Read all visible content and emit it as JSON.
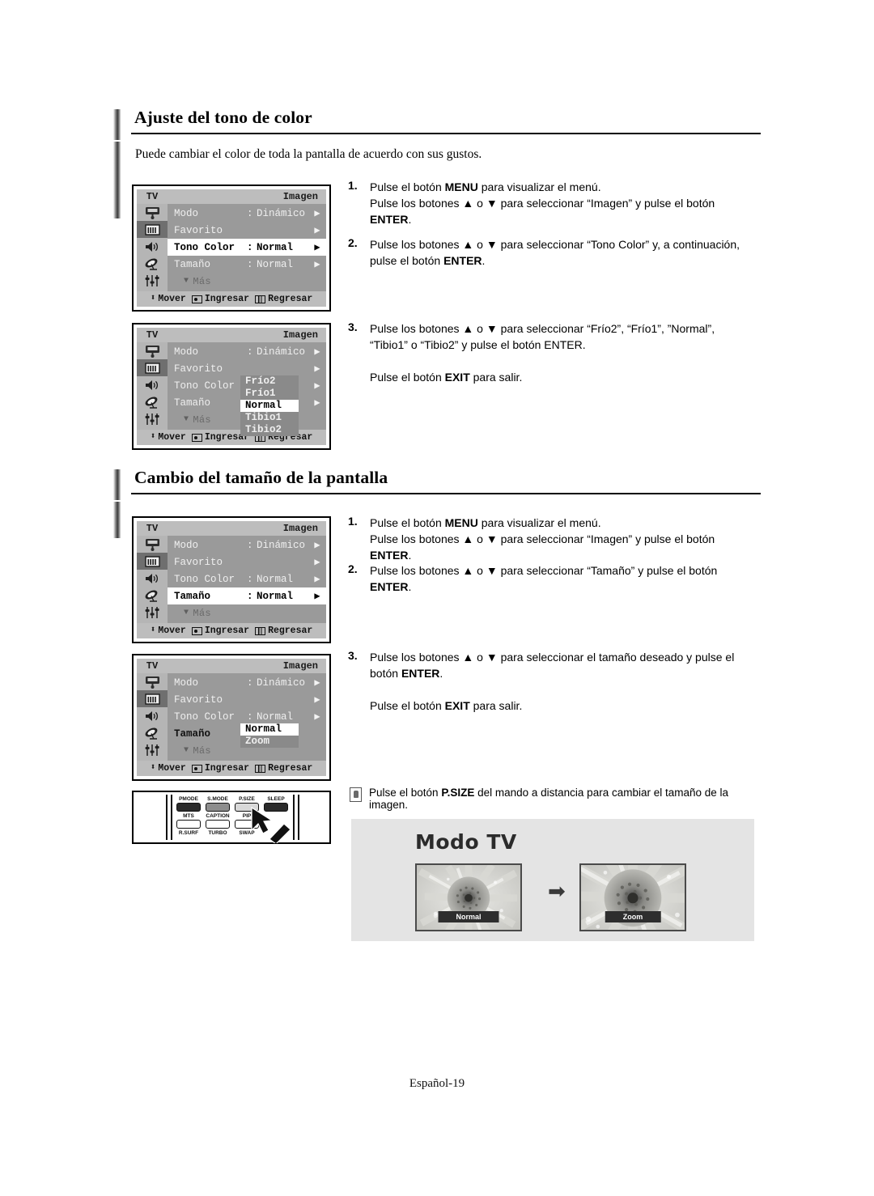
{
  "page": {
    "footer": "Español-19"
  },
  "sections": [
    {
      "heading": "Ajuste del tono de color",
      "intro": "Puede cambiar el color de toda la pantalla de acuerdo con sus gustos."
    },
    {
      "heading": "Cambio del tamaño de la pantalla",
      "intro": ""
    }
  ],
  "osd": {
    "tv_label": "TV",
    "title": "Imagen",
    "footer": {
      "move": "Mover",
      "enter": "Ingresar",
      "return": "Regresar",
      "move_icon": "up-down-arrow-icon",
      "enter_icon": "enter-button-icon",
      "return_icon": "menu-button-icon"
    },
    "more_label": "Más",
    "rail_icons": [
      "tv-input-icon",
      "picture-bars-icon",
      "speaker-icon",
      "satellite-dish-icon",
      "sliders-icon"
    ],
    "rows": {
      "modo": {
        "label": "Modo",
        "colon": ":",
        "value": "Dinámico"
      },
      "favorito": {
        "label": "Favorito",
        "colon": "",
        "value": ""
      },
      "tono_color": {
        "label": "Tono Color",
        "colon": ":",
        "value": "Normal"
      },
      "tamano": {
        "label": "Tamaño",
        "colon": ":",
        "value": "Normal"
      }
    },
    "tono_color_options": [
      "Frío2",
      "Frío1",
      "Normal",
      "Tibio1",
      "Tibio2"
    ],
    "tono_color_selected": "Normal",
    "tamano_options": [
      "Normal",
      "Zoom"
    ],
    "tamano_selected": "Normal"
  },
  "instructions_color": [
    {
      "num": "1.",
      "lines": [
        [
          {
            "t": "Pulse el botón "
          },
          {
            "t": "MENU",
            "b": true
          },
          {
            "t": " para visualizar el menú."
          }
        ],
        [
          {
            "t": "Pulse los botones ▲ o ▼ para seleccionar “Imagen” y pulse el botón"
          }
        ],
        [
          {
            "t": "ENTER",
            "b": true
          },
          {
            "t": "."
          }
        ]
      ]
    },
    {
      "num": "2.",
      "lines": [
        [
          {
            "t": "Pulse los botones ▲ o ▼ para seleccionar “Tono Color” y, a continuación,"
          }
        ],
        [
          {
            "t": "pulse el botón "
          },
          {
            "t": "ENTER",
            "b": true
          },
          {
            "t": "."
          }
        ]
      ]
    },
    {
      "num": "3.",
      "lines": [
        [
          {
            "t": "Pulse los botones ▲ o ▼ para seleccionar “Frío2”, “Frío1”, ”Normal”,"
          }
        ],
        [
          {
            "t": "“Tibio1” o “Tibio2” y pulse el botón ENTER."
          }
        ],
        [
          {
            "t": ""
          }
        ],
        [
          {
            "t": "Pulse el botón "
          },
          {
            "t": "EXIT",
            "b": true
          },
          {
            "t": " para salir."
          }
        ]
      ]
    }
  ],
  "instructions_size": [
    {
      "num": "1.",
      "lines": [
        [
          {
            "t": "Pulse el botón "
          },
          {
            "t": "MENU",
            "b": true
          },
          {
            "t": " para visualizar el menú."
          }
        ],
        [
          {
            "t": "Pulse los botones ▲ o ▼ para seleccionar “Imagen” y pulse el botón"
          }
        ],
        [
          {
            "t": "ENTER",
            "b": true
          },
          {
            "t": "."
          }
        ]
      ]
    },
    {
      "num": "2.",
      "lines": [
        [
          {
            "t": "Pulse los botones ▲ o ▼ para seleccionar “Tamaño” y pulse el botón"
          }
        ],
        [
          {
            "t": "ENTER",
            "b": true
          },
          {
            "t": "."
          }
        ]
      ]
    },
    {
      "num": "3.",
      "lines": [
        [
          {
            "t": "Pulse los botones ▲ o ▼ para seleccionar el tamaño deseado y pulse el"
          }
        ],
        [
          {
            "t": "botón "
          },
          {
            "t": "ENTER",
            "b": true
          },
          {
            "t": "."
          }
        ],
        [
          {
            "t": ""
          }
        ],
        [
          {
            "t": "Pulse el botón "
          },
          {
            "t": "EXIT",
            "b": true
          },
          {
            "t": " para salir."
          }
        ]
      ]
    }
  ],
  "note": {
    "icon": "hand-note-icon",
    "lines": [
      [
        {
          "t": "Pulse el botón "
        },
        {
          "t": "P.SIZE",
          "b": true
        },
        {
          "t": " del mando a distancia para cambiar el tamaño de la imagen."
        }
      ]
    ]
  },
  "remote": {
    "keys_row1": [
      "PMODE",
      "S.MODE",
      "P.SIZE",
      "SLEEP"
    ],
    "keys_row2": [
      "MTS",
      "CAPTION",
      "PIP"
    ],
    "keys_row3": [
      "R.SURF",
      "TURBO",
      "SWAP"
    ],
    "highlighted_key": "P.SIZE",
    "cursor_icon": "mouse-pointer-icon"
  },
  "modo_tv": {
    "title": "Modo TV",
    "left_label": "Normal",
    "right_label": "Zoom",
    "arrow_icon": "right-arrow-icon"
  },
  "colors": {
    "osd_bg": "#9a9a9a",
    "osd_bar": "#bdbdbd",
    "osd_selected": "#ffffff",
    "panel_bg": "#e4e4e4",
    "rule": "#000000"
  }
}
